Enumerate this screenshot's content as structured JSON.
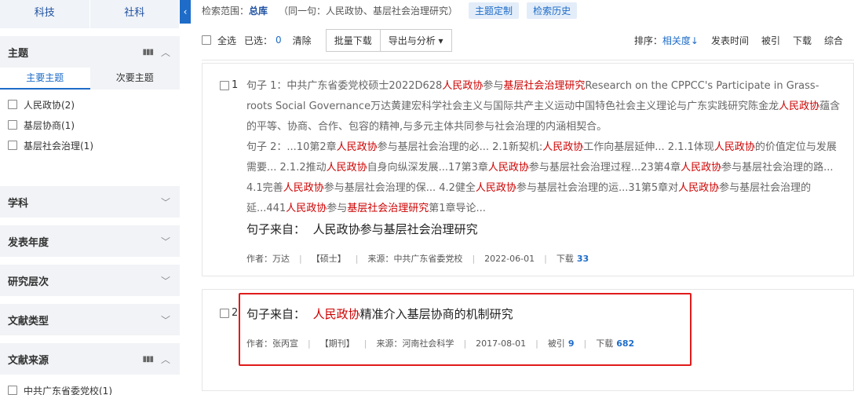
{
  "sidebar": {
    "top_tabs": [
      "科技",
      "社科"
    ],
    "collapse_icon": "‹",
    "theme_panel": {
      "title": "主题",
      "subtabs": [
        "主要主题",
        "次要主题"
      ],
      "items": [
        "人民政协(2)",
        "基层协商(1)",
        "基层社会治理(1)"
      ]
    },
    "panels": [
      "学科",
      "发表年度",
      "研究层次",
      "文献类型"
    ],
    "source_panel": {
      "title": "文献来源",
      "items": [
        "中共广东省委党校(1)"
      ]
    }
  },
  "main": {
    "scope": {
      "label": "检索范围：",
      "value": "总库",
      "sentence": "（同一句：人民政协、基层社会治理研究）",
      "btn_custom": "主题定制",
      "btn_history": "检索历史"
    },
    "toolbar": {
      "select_all": "全选",
      "selected_label": "已选：",
      "selected_count": "0",
      "clear": "清除",
      "batch_download": "批量下载",
      "export": "导出与分析 ▾",
      "sort_label": "排序：",
      "sort_active": "相关度↓",
      "sort_options": [
        "发表时间",
        "被引",
        "下载",
        "综合"
      ]
    },
    "results": [
      {
        "num": "1",
        "sentence1_prefix": "句子 1：中共广东省委党校硕士2022D628",
        "sentence1_hl1": "人民政协",
        "sentence1_mid": "参与",
        "sentence1_hl2": "基层社会治理研究",
        "sentence1_rest": "Research on the CPPCC's Participate in Grass-roots Social Governance万达黄建宏科学社会主义与国际共产主义运动中国特色社会主义理论与广东实践研究陈金龙",
        "sentence1_hl3": "人民政协",
        "sentence1_end": "蕴含的平等、协商、合作、包容的精神,与多元主体共同参与社会治理的内涵相契合。",
        "sentence2_p1": "句子 2：...10第2章",
        "hl_a": "人民政协",
        "sentence2_p2": "参与基层社会治理的必... 2.1新契机:",
        "hl_b": "人民政协",
        "sentence2_p3": "工作向基层延伸... 2.1.1体现",
        "hl_c": "人民政协",
        "sentence2_p4": "的价值定位与发展需要... 2.1.2推动",
        "hl_d": "人民政协",
        "sentence2_p5": "自身向纵深发展...17第3章",
        "hl_e": "人民政协",
        "sentence2_p6": "参与基层社会治理过程...23第4章",
        "hl_f": "人民政协",
        "sentence2_p7": "参与基层社会治理的路... 4.1完善",
        "hl_g": "人民政协",
        "sentence2_p8": "参与基层社会治理的保... 4.2健全",
        "hl_h": "人民政协",
        "sentence2_p9": "参与基层社会治理的运...31第5章对",
        "hl_i": "人民政协",
        "sentence2_p10": "参与基层社会治理的延...441",
        "hl_j": "人民政协",
        "sentence2_p11": "参与",
        "hl_k": "基层社会治理研究",
        "sentence2_p12": "第1章导论...",
        "source_label": "句子来自：",
        "source_title": "人民政协参与基层社会治理研究",
        "author_label": "作者：",
        "author": "万达",
        "type": "【硕士】",
        "source_org_label": "来源：",
        "source_org": "中共广东省委党校",
        "date": "2022-06-01",
        "download_label": "下载",
        "download_count": "33"
      },
      {
        "num": "2",
        "source_label": "句子来自：",
        "source_title_hl": "人民政协",
        "source_title_rest": "精准介入基层协商的机制研究",
        "author_label": "作者：",
        "author": "张丙宣",
        "type": "【期刊】",
        "source_org_label": "来源：",
        "source_org": "河南社会科学",
        "date": "2017-08-01",
        "cite_label": "被引",
        "cite_count": "9",
        "download_label": "下载",
        "download_count": "682"
      }
    ]
  },
  "colors": {
    "accent": "#1e6cc8",
    "highlight": "#cc0000",
    "annotation_box": "#e01b1b"
  }
}
